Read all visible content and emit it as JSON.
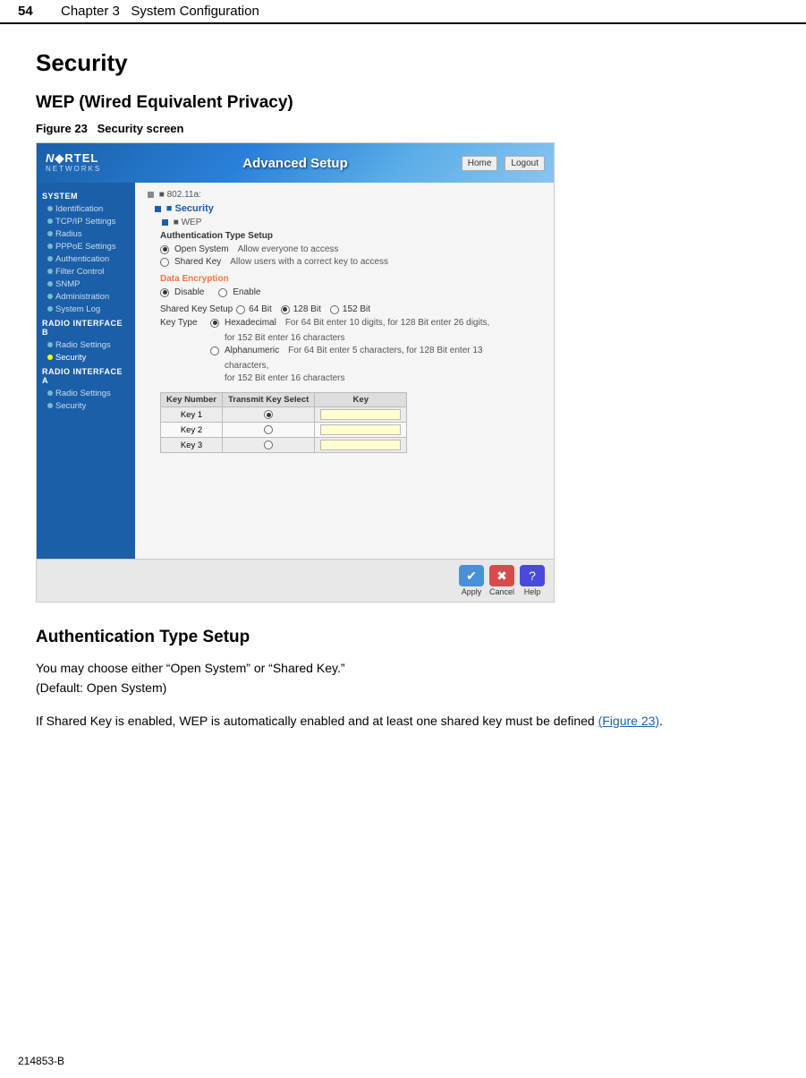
{
  "header": {
    "page_num": "54",
    "chapter": "Chapter 3",
    "chapter_title": "System Configuration",
    "footer_text": "214853-B"
  },
  "section": {
    "title": "Security",
    "subsection_wep": {
      "title": "WEP (Wired Equivalent Privacy)",
      "figure_label": "Figure 23",
      "figure_caption": "Security screen"
    },
    "subsection_auth": {
      "title": "Authentication Type Setup",
      "paragraph1": "You may choose either “Open System” or “Shared Key.”\n(Default: Open System)",
      "paragraph2": "If Shared Key is enabled, WEP is automatically enabled and at least one shared key must be defined",
      "figure_ref": "(Figure 23).",
      "figure_ref_link": "Figure 23"
    }
  },
  "screenshot": {
    "header_title": "Advanced Setup",
    "nav_home": "Home",
    "nav_logout": "Logout",
    "nortel_name": "N◆RTEL",
    "nortel_networks": "NETWORKS",
    "sidebar": {
      "group1_title": "SYSTEM",
      "items": [
        "Identification",
        "TCP/IP Settings",
        "Radius",
        "PPPoE Settings",
        "Authentication",
        "Filter Control",
        "SNMP",
        "Administration",
        "System Log"
      ],
      "group2_title": "RADIO INTERFACE B",
      "items2": [
        "Radio Settings",
        "Security"
      ],
      "group3_title": "RADIO INTERFACE A",
      "items3": [
        "Radio Settings",
        "Security"
      ]
    },
    "content": {
      "link_802": "■ 802.11a:",
      "link_security": "■ Security",
      "link_wep": "■ WEP",
      "auth_title": "Authentication Type Setup",
      "radio_open": "Open System",
      "radio_open_desc": "Allow everyone to access",
      "radio_shared": "Shared Key",
      "radio_shared_desc": "Allow users with a correct key to access",
      "data_enc_title": "Data Encryption",
      "radio_disable": "Disable",
      "radio_enable": "Enable",
      "shared_key_title": "Shared Key Setup",
      "bit64": "64 Bit",
      "bit128": "128 Bit",
      "bit152": "152 Bit",
      "key_type": "Key Type",
      "hexadecimal": "Hexadecimal",
      "hex_desc": "For 64 Bit enter 10 digits, for 128 Bit enter 26 digits,",
      "hex_desc2": "for 152 Bit enter 16 characters",
      "alphanumeric": "Alphanumeric",
      "alpha_desc": "For 64 Bit enter 5 characters, for 128 Bit enter 13",
      "alpha_desc2": "characters,",
      "alpha_desc3": "for 152 Bit enter 16 characters",
      "table_col1": "Key Number",
      "table_col2": "Transmit Key Select",
      "table_col3": "Key",
      "key1": "Key 1",
      "key2": "Key 2",
      "key3": "Key 3",
      "btn_apply": "Apply",
      "btn_cancel": "Cancel",
      "btn_help": "Help"
    }
  }
}
